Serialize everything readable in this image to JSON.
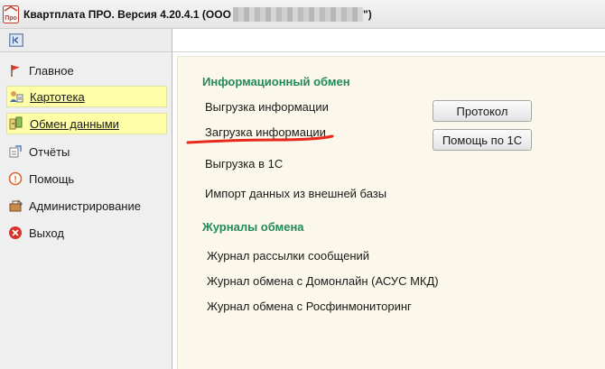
{
  "window": {
    "title_prefix": "Квартплата ПРО.  Версия 4.20.4.1 (ООО \"",
    "title_suffix": "\")",
    "app_icon_text": "Про"
  },
  "sidebar": {
    "items": [
      {
        "label": "Главное",
        "icon": "flag-icon",
        "highlighted": false
      },
      {
        "label": "Картотека",
        "icon": "cards-icon",
        "highlighted": true
      },
      {
        "label": "Обмен данными",
        "icon": "exchange-icon",
        "highlighted": true
      },
      {
        "label": "Отчёты",
        "icon": "reports-icon",
        "highlighted": false
      },
      {
        "label": "Помощь",
        "icon": "help-icon",
        "highlighted": false
      },
      {
        "label": "Администрирование",
        "icon": "admin-icon",
        "highlighted": false
      },
      {
        "label": "Выход",
        "icon": "exit-icon",
        "highlighted": false
      }
    ]
  },
  "main": {
    "section_exchange": "Информационный обмен",
    "links": {
      "export_info": "Выгрузка информации",
      "import_info": "Загрузка информации",
      "export_1c": "Выгрузка в 1С",
      "import_external": "Импорт данных из внешней базы"
    },
    "buttons": {
      "protocol": "Протокол",
      "help_1c": "Помощь по 1С"
    },
    "section_journals": "Журналы обмена",
    "journals": {
      "mailing": "Журнал  рассылки сообщений",
      "domonline": "Журнал обмена с Домонлайн (АСУС МКД)",
      "rosfin": "Журнал обмена с Росфинмониторинг"
    }
  },
  "colors": {
    "section_title": "#238a58",
    "highlight": "#ffffa8",
    "annotation": "#e8281c"
  }
}
